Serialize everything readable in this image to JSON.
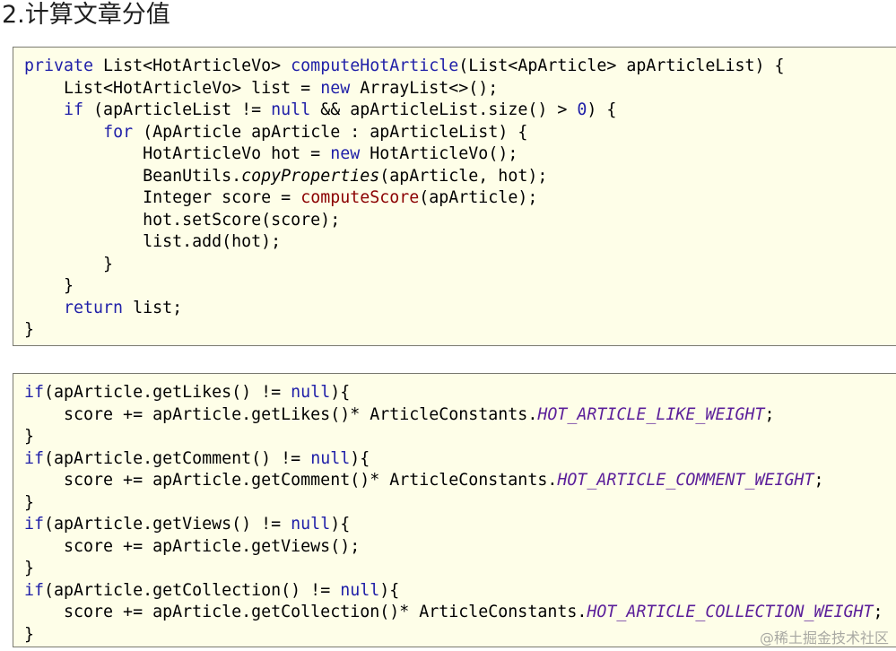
{
  "title": "2.计算文章分值",
  "colors": {
    "keyword": "#1f1fa8",
    "method_highlight": "#8b0000",
    "constant": "#5b1f9a",
    "block_bg": "#fefee8"
  },
  "blocks": [
    {
      "lines": [
        [
          {
            "t": "private",
            "c": "kw"
          },
          {
            "t": " List<HotArticleVo> "
          },
          {
            "t": "computeHotArticle",
            "c": "kw"
          },
          {
            "t": "(List<ApArticle> apArticleList) {"
          }
        ],
        [
          {
            "t": "    List<HotArticleVo> list = "
          },
          {
            "t": "new",
            "c": "kw"
          },
          {
            "t": " ArrayList<>();"
          }
        ],
        [
          {
            "t": "    "
          },
          {
            "t": "if",
            "c": "kw"
          },
          {
            "t": " (apArticleList != "
          },
          {
            "t": "null",
            "c": "kw"
          },
          {
            "t": " && apArticleList.size() > "
          },
          {
            "t": "0",
            "c": "kw"
          },
          {
            "t": ") {"
          }
        ],
        [
          {
            "t": "        "
          },
          {
            "t": "for",
            "c": "kw"
          },
          {
            "t": " (ApArticle apArticle : apArticleList) {"
          }
        ],
        [
          {
            "t": "            HotArticleVo hot = "
          },
          {
            "t": "new",
            "c": "kw"
          },
          {
            "t": " HotArticleVo();"
          }
        ],
        [
          {
            "t": "            BeanUtils."
          },
          {
            "t": "copyProperties",
            "c": "ital"
          },
          {
            "t": "(apArticle, hot);"
          }
        ],
        [
          {
            "t": "            Integer score = "
          },
          {
            "t": "computeScore",
            "c": "fn-red"
          },
          {
            "t": "(apArticle);"
          }
        ],
        [
          {
            "t": "            hot.setScore(score);"
          }
        ],
        [
          {
            "t": "            list.add(hot);"
          }
        ],
        [
          {
            "t": "        }"
          }
        ],
        [
          {
            "t": "    }"
          }
        ],
        [
          {
            "t": "    "
          },
          {
            "t": "return",
            "c": "kw"
          },
          {
            "t": " list;"
          }
        ],
        [
          {
            "t": "}"
          }
        ]
      ]
    },
    {
      "lines": [
        [
          {
            "t": "if",
            "c": "kw"
          },
          {
            "t": "(apArticle.getLikes() != "
          },
          {
            "t": "null",
            "c": "kw"
          },
          {
            "t": "){"
          }
        ],
        [
          {
            "t": "    score += apArticle.getLikes()* ArticleConstants."
          },
          {
            "t": "HOT_ARTICLE_LIKE_WEIGHT",
            "c": "const"
          },
          {
            "t": ";"
          }
        ],
        [
          {
            "t": "}"
          }
        ],
        [
          {
            "t": "if",
            "c": "kw"
          },
          {
            "t": "(apArticle.getComment() != "
          },
          {
            "t": "null",
            "c": "kw"
          },
          {
            "t": "){"
          }
        ],
        [
          {
            "t": "    score += apArticle.getComment()* ArticleConstants."
          },
          {
            "t": "HOT_ARTICLE_COMMENT_WEIGHT",
            "c": "const"
          },
          {
            "t": ";"
          }
        ],
        [
          {
            "t": "}"
          }
        ],
        [
          {
            "t": "if",
            "c": "kw"
          },
          {
            "t": "(apArticle.getViews() != "
          },
          {
            "t": "null",
            "c": "kw"
          },
          {
            "t": "){"
          }
        ],
        [
          {
            "t": "    score += apArticle.getViews();"
          }
        ],
        [
          {
            "t": "}"
          }
        ],
        [
          {
            "t": "if",
            "c": "kw"
          },
          {
            "t": "(apArticle.getCollection() != "
          },
          {
            "t": "null",
            "c": "kw"
          },
          {
            "t": "){"
          }
        ],
        [
          {
            "t": "    score += apArticle.getCollection()* ArticleConstants."
          },
          {
            "t": "HOT_ARTICLE_COLLECTION_WEIGHT",
            "c": "const"
          },
          {
            "t": ";"
          }
        ],
        [
          {
            "t": "}"
          }
        ]
      ]
    }
  ],
  "watermark": "@稀土掘金技术社区"
}
